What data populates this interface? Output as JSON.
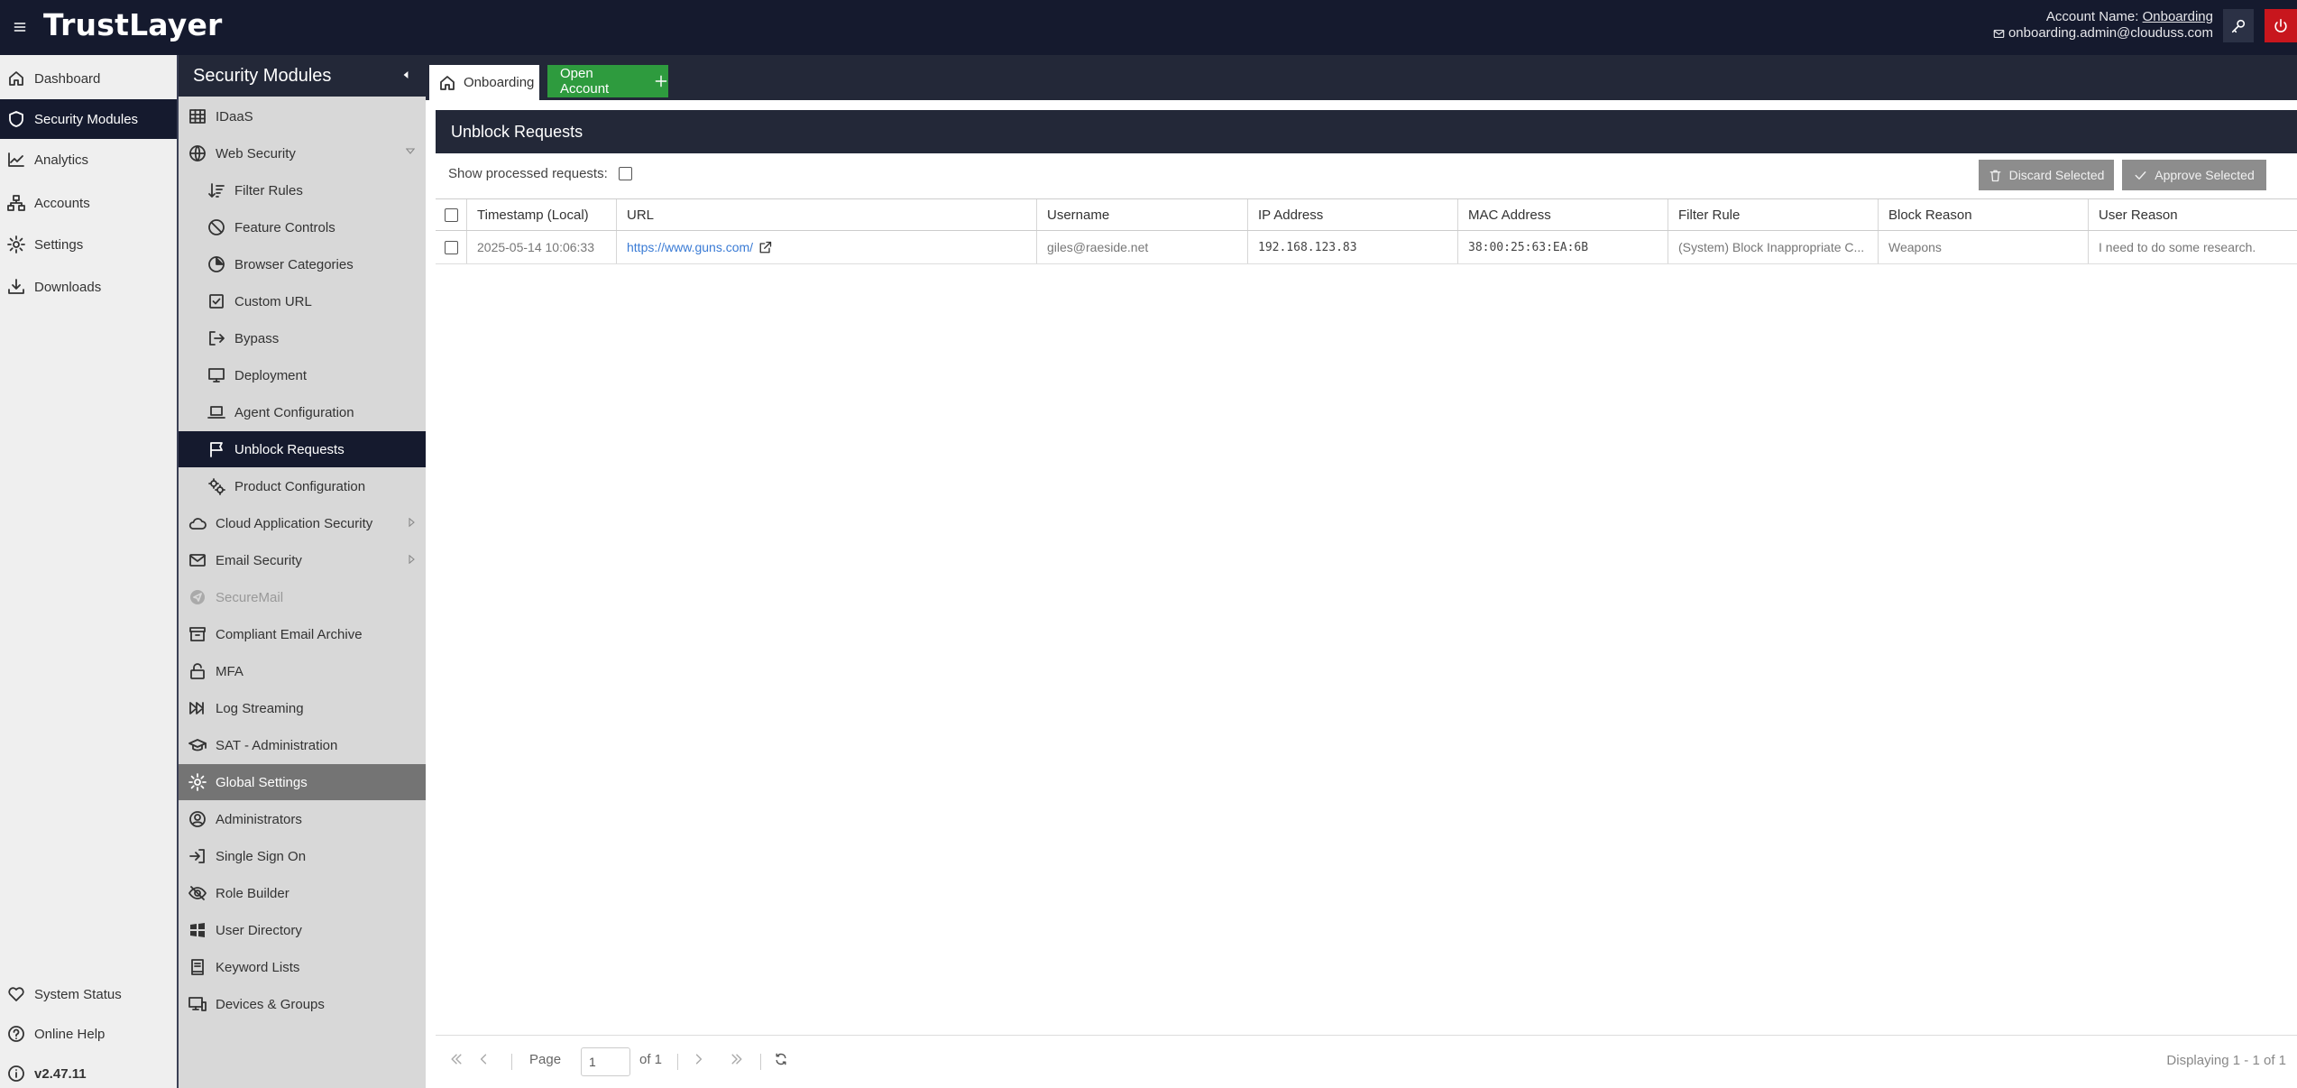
{
  "app": {
    "logo": "TrustLayer",
    "account_label": "Account Name:",
    "account_name": "Onboarding",
    "email": "onboarding.admin@clouduss.com"
  },
  "leftnav": {
    "items": [
      {
        "label": "Dashboard",
        "icon": "home-icon"
      },
      {
        "label": "Security Modules",
        "icon": "shield-icon",
        "active": true
      },
      {
        "label": "Analytics",
        "icon": "chart-icon"
      },
      {
        "label": "Accounts",
        "icon": "hierarchy-icon"
      },
      {
        "label": "Settings",
        "icon": "gear-icon"
      },
      {
        "label": "Downloads",
        "icon": "download-icon"
      }
    ],
    "bottom": [
      {
        "label": "System Status",
        "icon": "heart-icon"
      },
      {
        "label": "Online Help",
        "icon": "help-icon"
      },
      {
        "label": "v2.47.11",
        "icon": "info-icon"
      }
    ]
  },
  "modules": {
    "title": "Security Modules",
    "items": [
      {
        "label": "IDaaS",
        "icon": "grid-icon",
        "level": 0
      },
      {
        "label": "Web Security",
        "icon": "globe-icon",
        "level": 0,
        "expanded": true
      },
      {
        "label": "Filter Rules",
        "icon": "sort-icon",
        "level": 1
      },
      {
        "label": "Feature Controls",
        "icon": "ban-icon",
        "level": 1
      },
      {
        "label": "Browser Categories",
        "icon": "pie-icon",
        "level": 1
      },
      {
        "label": "Custom URL",
        "icon": "checkbox-icon",
        "level": 1
      },
      {
        "label": "Bypass",
        "icon": "exit-icon",
        "level": 1
      },
      {
        "label": "Deployment",
        "icon": "monitor-icon",
        "level": 1
      },
      {
        "label": "Agent Configuration",
        "icon": "laptop-icon",
        "level": 1
      },
      {
        "label": "Unblock Requests",
        "icon": "flag-icon",
        "level": 1,
        "active": true
      },
      {
        "label": "Product Configuration",
        "icon": "gears-icon",
        "level": 1
      },
      {
        "label": "Cloud Application Security",
        "icon": "cloud-icon",
        "level": 0,
        "arrow": true
      },
      {
        "label": "Email Security",
        "icon": "mail-icon",
        "level": 0,
        "arrow": true
      },
      {
        "label": "SecureMail",
        "icon": "send-icon",
        "level": 0,
        "disabled": true
      },
      {
        "label": "Compliant Email Archive",
        "icon": "archive-icon",
        "level": 0
      },
      {
        "label": "MFA",
        "icon": "lock-icon",
        "level": 0
      },
      {
        "label": "Log Streaming",
        "icon": "stream-icon",
        "level": 0
      },
      {
        "label": "SAT - Administration",
        "icon": "graduation-icon",
        "level": 0
      },
      {
        "label": "Global Settings",
        "icon": "gear-icon",
        "level": 0,
        "global": true
      },
      {
        "label": "Administrators",
        "icon": "user-circle-icon",
        "level": 0
      },
      {
        "label": "Single Sign On",
        "icon": "sign-in-icon",
        "level": 0
      },
      {
        "label": "Role Builder",
        "icon": "eye-slash-icon",
        "level": 0
      },
      {
        "label": "User Directory",
        "icon": "windows-icon",
        "level": 0
      },
      {
        "label": "Keyword Lists",
        "icon": "book-icon",
        "level": 0
      },
      {
        "label": "Devices & Groups",
        "icon": "devices-icon",
        "level": 0
      }
    ]
  },
  "tabs": {
    "home": "Onboarding",
    "open_account": "Open Account"
  },
  "panel": {
    "title": "Unblock Requests",
    "show_processed_label": "Show processed requests:",
    "discard_label": "Discard Selected",
    "approve_label": "Approve Selected"
  },
  "grid": {
    "columns": [
      "Timestamp (Local)",
      "URL",
      "Username",
      "IP Address",
      "MAC Address",
      "Filter Rule",
      "Block Reason",
      "User Reason"
    ],
    "rows": [
      {
        "timestamp": "2025-05-14 10:06:33",
        "url": "https://www.guns.com/",
        "username": "giles@raeside.net",
        "ip": "192.168.123.83",
        "mac": "38:00:25:63:EA:6B",
        "filter_rule": "(System) Block Inappropriate C...",
        "block_reason": "Weapons",
        "user_reason": "I need to do some research."
      }
    ]
  },
  "pager": {
    "page_label": "Page",
    "page_value": "1",
    "of_label": "of 1",
    "displaying": "Displaying 1 - 1 of 1"
  }
}
